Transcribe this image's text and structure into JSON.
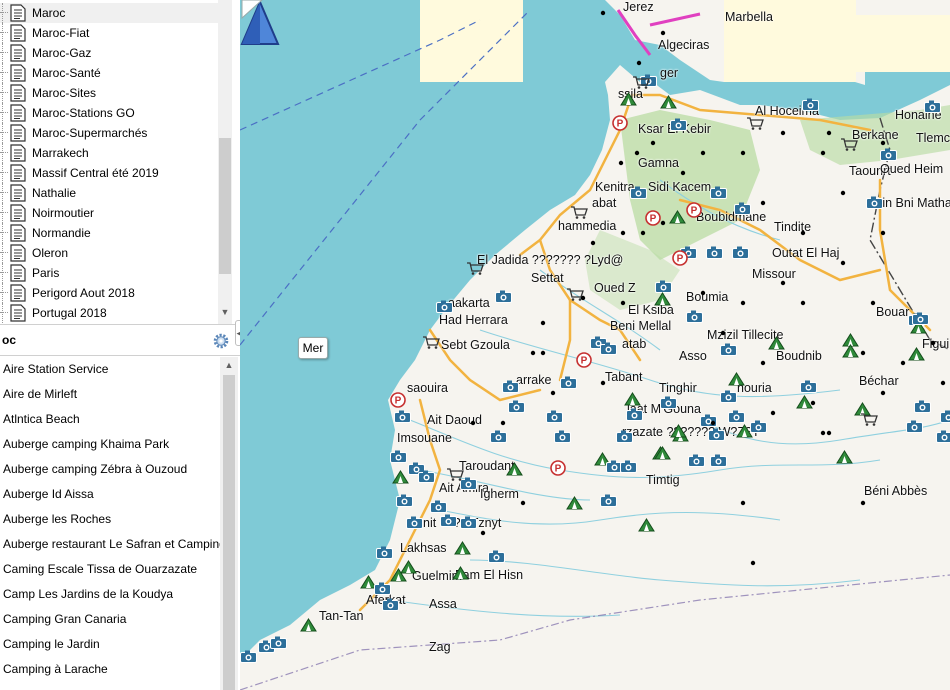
{
  "collections": {
    "items": [
      {
        "label": "Maroc",
        "selected": true
      },
      {
        "label": "Maroc-Fiat"
      },
      {
        "label": "Maroc-Gaz"
      },
      {
        "label": "Maroc-Santé"
      },
      {
        "label": "Maroc-Sites"
      },
      {
        "label": "Maroc-Stations GO"
      },
      {
        "label": "Maroc-Supermarchés"
      },
      {
        "label": "Marrakech"
      },
      {
        "label": "Massif Central été 2019"
      },
      {
        "label": "Nathalie"
      },
      {
        "label": "Noirmoutier"
      },
      {
        "label": "Normandie"
      },
      {
        "label": "Oleron"
      },
      {
        "label": "Paris"
      },
      {
        "label": "Perigord Aout 2018"
      },
      {
        "label": "Portugal 2018"
      }
    ]
  },
  "places_header": "oc",
  "places": {
    "items": [
      "Aire Station Service",
      "Aire de Mirleft",
      "Atlntica Beach",
      "Auberge camping Khaima Park",
      "Auberge camping Zébra à Ouzoud",
      "Auberge Id Aissa",
      "Auberge les Roches",
      "Auberge restaurant Le Safran et Camping",
      "Caming Escale Tissa de Ouarzazate",
      "Camp Les Jardins de la Koudya",
      "Camping  Gran Canaria",
      "Camping  le Jardin",
      "Camping à Larache"
    ]
  },
  "map": {
    "sea_label": "Mer",
    "towns": [
      {
        "name": "Jerez"
      },
      {
        "name": "Marbella"
      },
      {
        "name": "Algeciras"
      },
      {
        "name": "ger"
      },
      {
        "name": "ssila"
      },
      {
        "name": "Al Hoceima"
      },
      {
        "name": "Honaine"
      },
      {
        "name": "Tlemc"
      },
      {
        "name": "Berkane"
      },
      {
        "name": "Ksar El Kebir"
      },
      {
        "name": "Gamna"
      },
      {
        "name": "Taourirt"
      },
      {
        "name": "Oued Heim"
      },
      {
        "name": "Kenitra"
      },
      {
        "name": "Sidi Kacem"
      },
      {
        "name": "abat"
      },
      {
        "name": "Ain Bni Matha"
      },
      {
        "name": "Boubidmane"
      },
      {
        "name": "Tindite"
      },
      {
        "name": "hammedia"
      },
      {
        "name": "Outat El Haj"
      },
      {
        "name": "El Jadida ??????? ?Lyd@"
      },
      {
        "name": "Missour"
      },
      {
        "name": "Settat"
      },
      {
        "name": "Oued Z"
      },
      {
        "name": "Boumia"
      },
      {
        "name": "aakarta"
      },
      {
        "name": "El Ksiba"
      },
      {
        "name": "Had Herrara"
      },
      {
        "name": "Bouar"
      },
      {
        "name": "Beni Mellal"
      },
      {
        "name": "Mzizil Tillecite"
      },
      {
        "name": "Sebt Gzoula"
      },
      {
        "name": "atab"
      },
      {
        "name": "Figui"
      },
      {
        "name": "Asso"
      },
      {
        "name": "Boudnib"
      },
      {
        "name": "Béchar"
      },
      {
        "name": "saouira"
      },
      {
        "name": "arrake"
      },
      {
        "name": "Tabant"
      },
      {
        "name": "Tinghir"
      },
      {
        "name": "houria"
      },
      {
        "name": "Ait Daoud"
      },
      {
        "name": "laat M'Gouna"
      },
      {
        "name": "Imsouane"
      },
      {
        "name": "rzazate ??????? W?Z?T"
      },
      {
        "name": "Taroudant"
      },
      {
        "name": "Timtig"
      },
      {
        "name": "Ait Amira"
      },
      {
        "name": "Igherm"
      },
      {
        "name": "Béni Abbès"
      },
      {
        "name": "iznit ???? Tznyt"
      },
      {
        "name": "Lakhsas"
      },
      {
        "name": "Fam El Hisn"
      },
      {
        "name": "Guelmim"
      },
      {
        "name": "Aferkat"
      },
      {
        "name": "Assa"
      },
      {
        "name": "Tan-Tan"
      },
      {
        "name": "Zag"
      }
    ]
  },
  "colors": {
    "sea": "#7fcad6",
    "land": "#f6f4ef",
    "water": "#8fd0df",
    "road": "#f2b340",
    "highway": "#e040c0"
  }
}
